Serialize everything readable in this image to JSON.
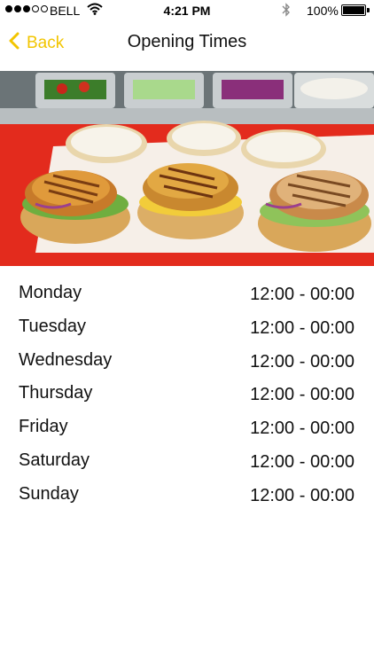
{
  "status_bar": {
    "carrier": "BELL",
    "time": "4:21 PM",
    "battery": "100%",
    "battery_level": 1.0,
    "signal_bars": [
      true,
      true,
      true,
      false,
      false
    ]
  },
  "nav": {
    "back_label": "Back",
    "title": "Opening Times",
    "accent_color": "#f2c500"
  },
  "hero": {
    "icon": "food-photo-burgers"
  },
  "opening_times": [
    {
      "day": "Monday",
      "hours": "12:00 - 00:00"
    },
    {
      "day": "Tuesday",
      "hours": "12:00 - 00:00"
    },
    {
      "day": "Wednesday",
      "hours": "12:00 - 00:00"
    },
    {
      "day": "Thursday",
      "hours": "12:00 - 00:00"
    },
    {
      "day": "Friday",
      "hours": "12:00 - 00:00"
    },
    {
      "day": "Saturday",
      "hours": "12:00 - 00:00"
    },
    {
      "day": "Sunday",
      "hours": "12:00 - 00:00"
    }
  ]
}
